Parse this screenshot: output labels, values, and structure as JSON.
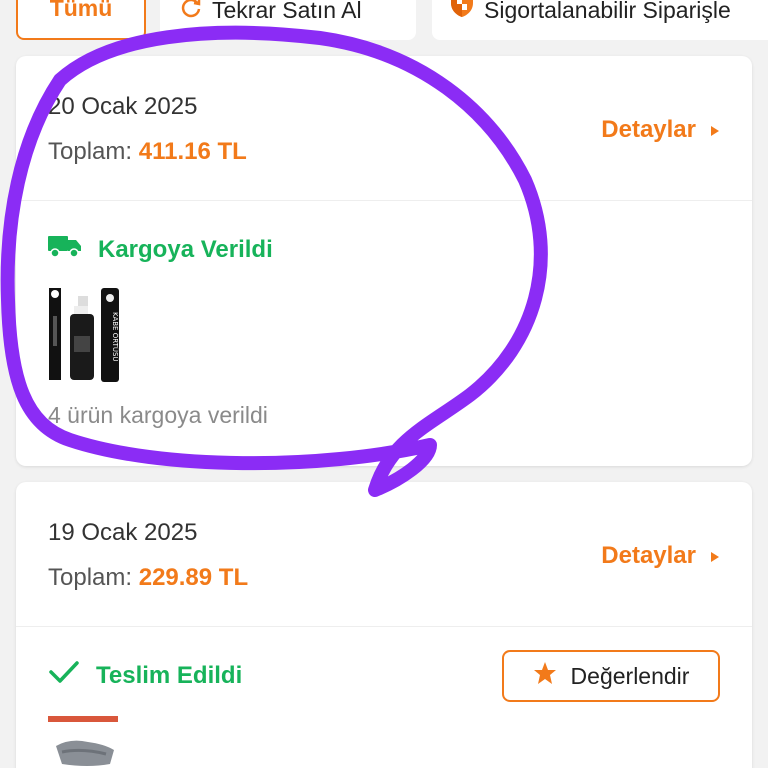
{
  "filters": {
    "all_label": "Tümü",
    "rebuy_label": "Tekrar Satın Al",
    "insurable_label": "Sigortalanabilir Siparişle"
  },
  "orders": [
    {
      "date": "20 Ocak 2025",
      "total_label": "Toplam:",
      "total_value": "411.16 TL",
      "details_label": "Detaylar",
      "status": "Kargoya Verildi",
      "status_icon": "truck-icon",
      "note": "4 ürün kargoya verildi",
      "product_box_text": "KABE ÖRTÜSÜ"
    },
    {
      "date": "19 Ocak 2025",
      "total_label": "Toplam:",
      "total_value": "229.89 TL",
      "details_label": "Detaylar",
      "status": "Teslim Edildi",
      "status_icon": "check-icon",
      "rate_label": "Değerlendir"
    }
  ],
  "colors": {
    "accent": "#f27a1a",
    "success": "#17b35a",
    "annotation": "#8b2cf5"
  }
}
